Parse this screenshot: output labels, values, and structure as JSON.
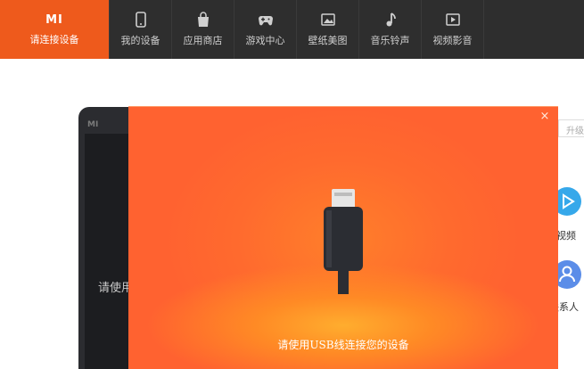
{
  "topbar": {
    "brand": {
      "logo": "MI",
      "label": "请连接设备"
    },
    "items": [
      {
        "label": "我的设备",
        "icon": "phone-icon"
      },
      {
        "label": "应用商店",
        "icon": "shopping-bag-icon"
      },
      {
        "label": "游戏中心",
        "icon": "gamepad-icon"
      },
      {
        "label": "壁纸美图",
        "icon": "picture-icon"
      },
      {
        "label": "音乐铃声",
        "icon": "music-note-icon"
      },
      {
        "label": "视频影音",
        "icon": "video-play-icon"
      }
    ]
  },
  "background": {
    "phone_logo": "MI",
    "phone_hint": "请使用",
    "side_button": "升级",
    "side_items": [
      {
        "label": "视频",
        "icon": "play-icon"
      },
      {
        "label": "联系人",
        "icon": "user-icon"
      }
    ]
  },
  "modal": {
    "close": "×",
    "message": "请使用USB线连接您的设备",
    "illustration": "usb-cable-icon"
  },
  "colors": {
    "brand": "#ee5a1c",
    "topbar": "#2e2e2e",
    "modal": "#ff6a2e"
  }
}
